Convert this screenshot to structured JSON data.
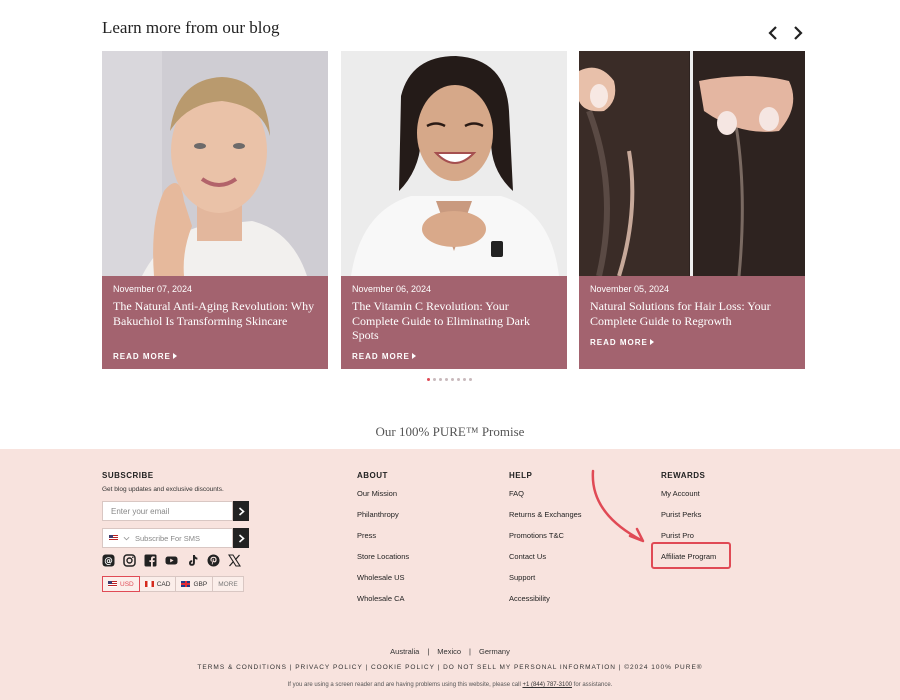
{
  "blog": {
    "title": "Learn more from our blog",
    "cards": [
      {
        "date": "November 07, 2024",
        "title": "The Natural Anti-Aging Revolution: Why Bakuchiol Is Transforming Skincare",
        "read_more": "READ MORE"
      },
      {
        "date": "November 06, 2024",
        "title": "The Vitamin C Revolution: Your Complete Guide to Eliminating Dark Spots",
        "read_more": "READ MORE"
      },
      {
        "date": "November 05, 2024",
        "title": "Natural Solutions for Hair Loss: Your Complete Guide to Regrowth",
        "read_more": "READ MORE"
      }
    ],
    "carousel_pages": 8,
    "carousel_active": 0
  },
  "promise": "Our 100% PURE™ Promise",
  "footer": {
    "subscribe": {
      "heading": "SUBSCRIBE",
      "description": "Get blog updates and exclusive discounts.",
      "email_placeholder": "Enter your email",
      "sms_placeholder": "Subscribe For SMS"
    },
    "socials": [
      "threads-icon",
      "instagram-icon",
      "facebook-icon",
      "youtube-icon",
      "tiktok-icon",
      "pinterest-icon",
      "x-icon"
    ],
    "currencies": [
      {
        "code": "USD",
        "flag": "us",
        "active": true
      },
      {
        "code": "CAD",
        "flag": "ca",
        "active": false
      },
      {
        "code": "GBP",
        "flag": "gb",
        "active": false
      },
      {
        "code": "MORE",
        "flag": "",
        "active": false
      }
    ],
    "about": {
      "heading": "ABOUT",
      "links": [
        "Our Mission",
        "Philanthropy",
        "Press",
        "Store Locations",
        "Wholesale US",
        "Wholesale CA"
      ]
    },
    "help": {
      "heading": "HELP",
      "links": [
        "FAQ",
        "Returns & Exchanges",
        "Promotions T&C",
        "Contact Us",
        "Support",
        "Accessibility"
      ]
    },
    "rewards": {
      "heading": "REWARDS",
      "links": [
        "My Account",
        "Purist Perks",
        "Purist Pro",
        "Affiliate Program"
      ]
    },
    "countries": [
      "Australia",
      "Mexico",
      "Germany"
    ],
    "legal": "TERMS & CONDITIONS | PRIVACY POLICY | COOKIE POLICY | DO NOT SELL MY PERSONAL INFORMATION | ©2024 100% PURE®",
    "a11y_prefix": "If you are using a screen reader and are having problems using this website, please call",
    "a11y_phone": "+1 (844) 787-3100",
    "a11y_suffix": "for assistance."
  },
  "colors": {
    "card": "#a3636f",
    "footer_bg": "#f8e3de",
    "accent": "#e04a55"
  }
}
